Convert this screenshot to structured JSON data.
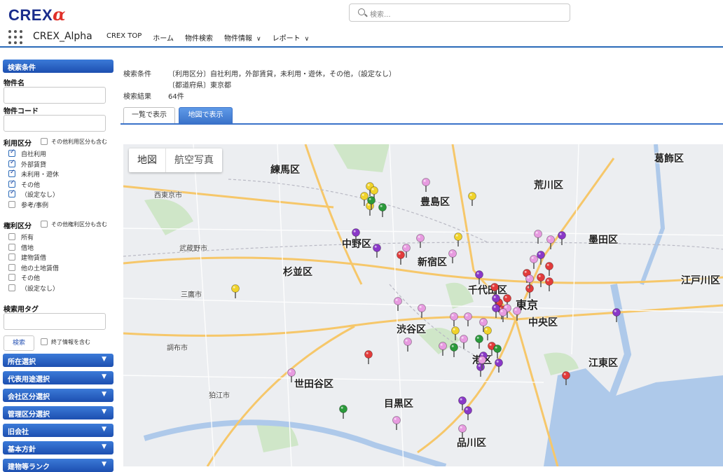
{
  "header": {
    "logo_text": "CREX",
    "logo_alpha": "α",
    "search_placeholder": "検索...",
    "app_name": "CREX_Alpha",
    "nav": [
      "CREX TOP",
      "ホーム",
      "物件検索",
      "物件情報",
      "レポート"
    ],
    "nav_dropdowns": [
      false,
      false,
      false,
      true,
      true
    ]
  },
  "sidebar": {
    "search_conditions_title": "検索条件",
    "property_name_label": "物件名",
    "property_code_label": "物件コード",
    "usage_label": "利用区分",
    "usage_other_include": "その他利用区分も含む",
    "usage_items": [
      {
        "label": "自社利用",
        "checked": true
      },
      {
        "label": "外部賃貸",
        "checked": true
      },
      {
        "label": "未利用・遊休",
        "checked": true
      },
      {
        "label": "その他",
        "checked": true
      },
      {
        "label": "（設定なし）",
        "checked": true
      },
      {
        "label": "参考/事例",
        "checked": false
      }
    ],
    "rights_label": "権利区分",
    "rights_other_include": "その他権利区分も含む",
    "rights_items": [
      {
        "label": "所有",
        "checked": false
      },
      {
        "label": "借地",
        "checked": false
      },
      {
        "label": "建物賃借",
        "checked": false
      },
      {
        "label": "他の土地賃借",
        "checked": false
      },
      {
        "label": "その他",
        "checked": false
      },
      {
        "label": "（設定なし）",
        "checked": false
      }
    ],
    "tag_label": "検索用タグ",
    "search_button": "検索",
    "include_ended": "終了情報を含む",
    "sections": [
      "所在選択",
      "代表用途選択",
      "会社区分選択",
      "管理区分選択",
      "旧会社",
      "基本方針",
      "建物等ランク"
    ]
  },
  "main": {
    "cond_label": "検索条件",
    "cond_line1": "〔利用区分〕自社利用，外部賃貸，未利用・遊休，その他，（設定なし）",
    "cond_line2": "〔都道府県〕東京都",
    "result_label": "検索結果",
    "result_value": "64件",
    "tab_list": "一覧で表示",
    "tab_map": "地図で表示"
  },
  "map": {
    "tab_map": "地図",
    "tab_satellite": "航空写真",
    "wards": [
      "練馬区",
      "豊島区",
      "中野区",
      "新宿区",
      "杉並区",
      "千代田区",
      "東京",
      "渋谷区",
      "中央区",
      "港区",
      "世田谷区",
      "目黒区",
      "品川区",
      "荒川区",
      "墨田区",
      "葛飾区",
      "江東区",
      "江戸川区"
    ],
    "cities": [
      "西東京市",
      "武蔵野市",
      "三鷹市",
      "調布市",
      "狛江市"
    ],
    "pins": [
      {
        "color": "#f0d32b"
      },
      {
        "color": "#f0d32b"
      },
      {
        "color": "#f0d32b"
      },
      {
        "color": "#f0d32b"
      },
      {
        "color": "#f0d32b"
      },
      {
        "color": "#f0d32b"
      },
      {
        "color": "#f0d32b"
      },
      {
        "color": "#f0d32b"
      },
      {
        "color": "#e23b3b"
      },
      {
        "color": "#e23b3b"
      },
      {
        "color": "#e23b3b"
      },
      {
        "color": "#e23b3b"
      },
      {
        "color": "#e23b3b"
      },
      {
        "color": "#e23b3b"
      },
      {
        "color": "#e23b3b"
      },
      {
        "color": "#e23b3b"
      },
      {
        "color": "#e23b3b"
      },
      {
        "color": "#e23b3b"
      },
      {
        "color": "#e23b3b"
      },
      {
        "color": "#e23b3b"
      },
      {
        "color": "#e79be0"
      },
      {
        "color": "#e79be0"
      },
      {
        "color": "#e79be0"
      },
      {
        "color": "#e79be0"
      },
      {
        "color": "#e79be0"
      },
      {
        "color": "#e79be0"
      },
      {
        "color": "#e79be0"
      },
      {
        "color": "#e79be0"
      },
      {
        "color": "#e79be0"
      },
      {
        "color": "#e79be0"
      },
      {
        "color": "#e79be0"
      },
      {
        "color": "#e79be0"
      },
      {
        "color": "#e79be0"
      },
      {
        "color": "#e79be0"
      },
      {
        "color": "#e79be0"
      },
      {
        "color": "#e79be0"
      },
      {
        "color": "#e79be0"
      },
      {
        "color": "#e79be0"
      },
      {
        "color": "#e79be0"
      },
      {
        "color": "#e79be0"
      },
      {
        "color": "#8a38c8"
      },
      {
        "color": "#8a38c8"
      },
      {
        "color": "#8a38c8"
      },
      {
        "color": "#8a38c8"
      },
      {
        "color": "#8a38c8"
      },
      {
        "color": "#8a38c8"
      },
      {
        "color": "#8a38c8"
      },
      {
        "color": "#8a38c8"
      },
      {
        "color": "#8a38c8"
      },
      {
        "color": "#8a38c8"
      },
      {
        "color": "#8a38c8"
      },
      {
        "color": "#8a38c8"
      },
      {
        "color": "#2a9a3a"
      },
      {
        "color": "#2a9a3a"
      },
      {
        "color": "#2a9a3a"
      },
      {
        "color": "#2a9a3a"
      },
      {
        "color": "#2a9a3a"
      },
      {
        "color": "#2a9a3a"
      },
      {
        "color": "#e79be0"
      },
      {
        "color": "#e79be0"
      },
      {
        "color": "#e23b3b"
      },
      {
        "color": "#8a38c8"
      },
      {
        "color": "#e79be0"
      },
      {
        "color": "#f0d32b"
      }
    ]
  }
}
